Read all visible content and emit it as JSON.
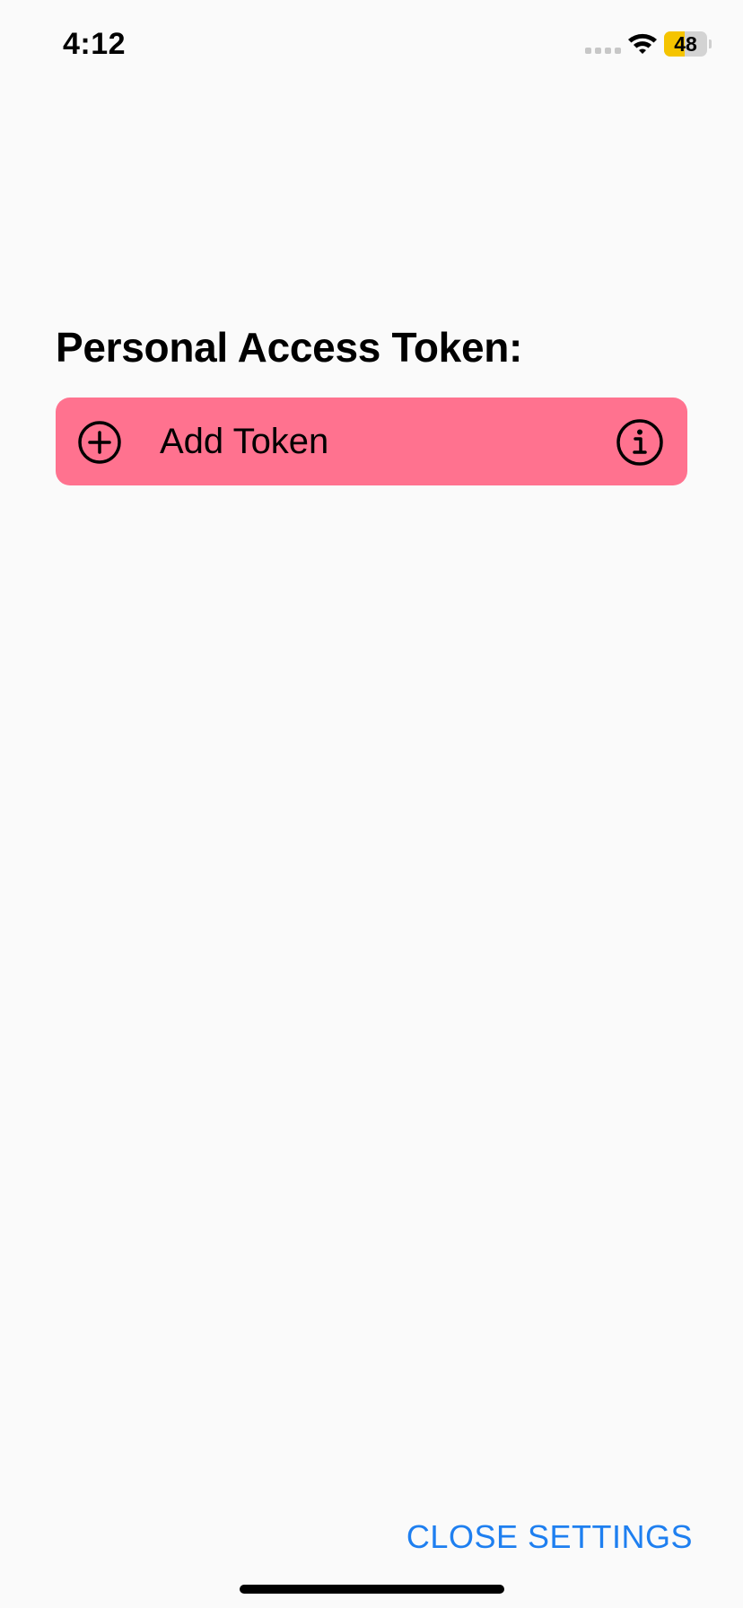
{
  "status_bar": {
    "time": "4:12",
    "battery_level": "48",
    "battery_fraction": 0.48,
    "battery_color": "#f5c400",
    "icons": [
      "cellular-signal-icon",
      "wifi-icon",
      "battery-icon"
    ]
  },
  "settings": {
    "section_title": "Personal Access Token:",
    "add_token": {
      "label": "Add Token",
      "background_color": "#ff728f",
      "leading_icon": "plus-circle-icon",
      "trailing_icon": "info-icon"
    },
    "close_button_label": "CLOSE SETTINGS",
    "accent_color": "#1e7ff0"
  }
}
